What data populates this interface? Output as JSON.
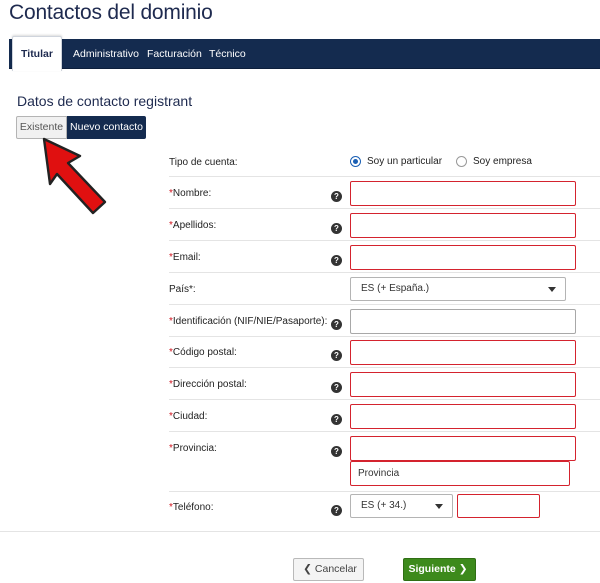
{
  "page": {
    "title": "Contactos del dominio"
  },
  "tabs": [
    "Titular",
    "Administrativo",
    "Facturación",
    "Técnico"
  ],
  "section": {
    "title": "Datos de contacto registrant",
    "existing_label": "Existente",
    "new_contact_label": "Nuevo contacto"
  },
  "account_type": {
    "label": "Tipo de cuenta:",
    "option_individual": "Soy un particular",
    "option_company": "Soy empresa",
    "selected": "Soy un particular"
  },
  "fields": {
    "required_mark": "*",
    "help_glyph": "?",
    "nombre": {
      "label": "Nombre:",
      "value": ""
    },
    "apellidos": {
      "label": "Apellidos:",
      "value": ""
    },
    "email": {
      "label": "Email:",
      "value": ""
    },
    "pais": {
      "label": "País",
      "suffix": "*:",
      "value": "ES (+ España.)"
    },
    "identificacion": {
      "label": "Identificación (NIF/NIE/Pasaporte):",
      "value": ""
    },
    "codigo_postal": {
      "label": "Código postal:",
      "value": ""
    },
    "direccion": {
      "label": "Dirección postal:",
      "value": ""
    },
    "ciudad": {
      "label": "Ciudad:",
      "value": ""
    },
    "provincia": {
      "label": "Provincia:",
      "value": "",
      "dropdown_option": "Provincia"
    },
    "telefono": {
      "label": "Teléfono:",
      "prefix_value": "ES (+ 34.)",
      "value": ""
    }
  },
  "buttons": {
    "cancel": "Cancelar",
    "next": "Siguiente",
    "back_chevron": "❮",
    "next_chevron": "❯"
  },
  "colors": {
    "navy": "#142b4f",
    "error_border": "#d4232e",
    "arrow_red": "#e01010",
    "primary_green": "#3d8a1c",
    "radio_blue": "#1a5fb4"
  }
}
